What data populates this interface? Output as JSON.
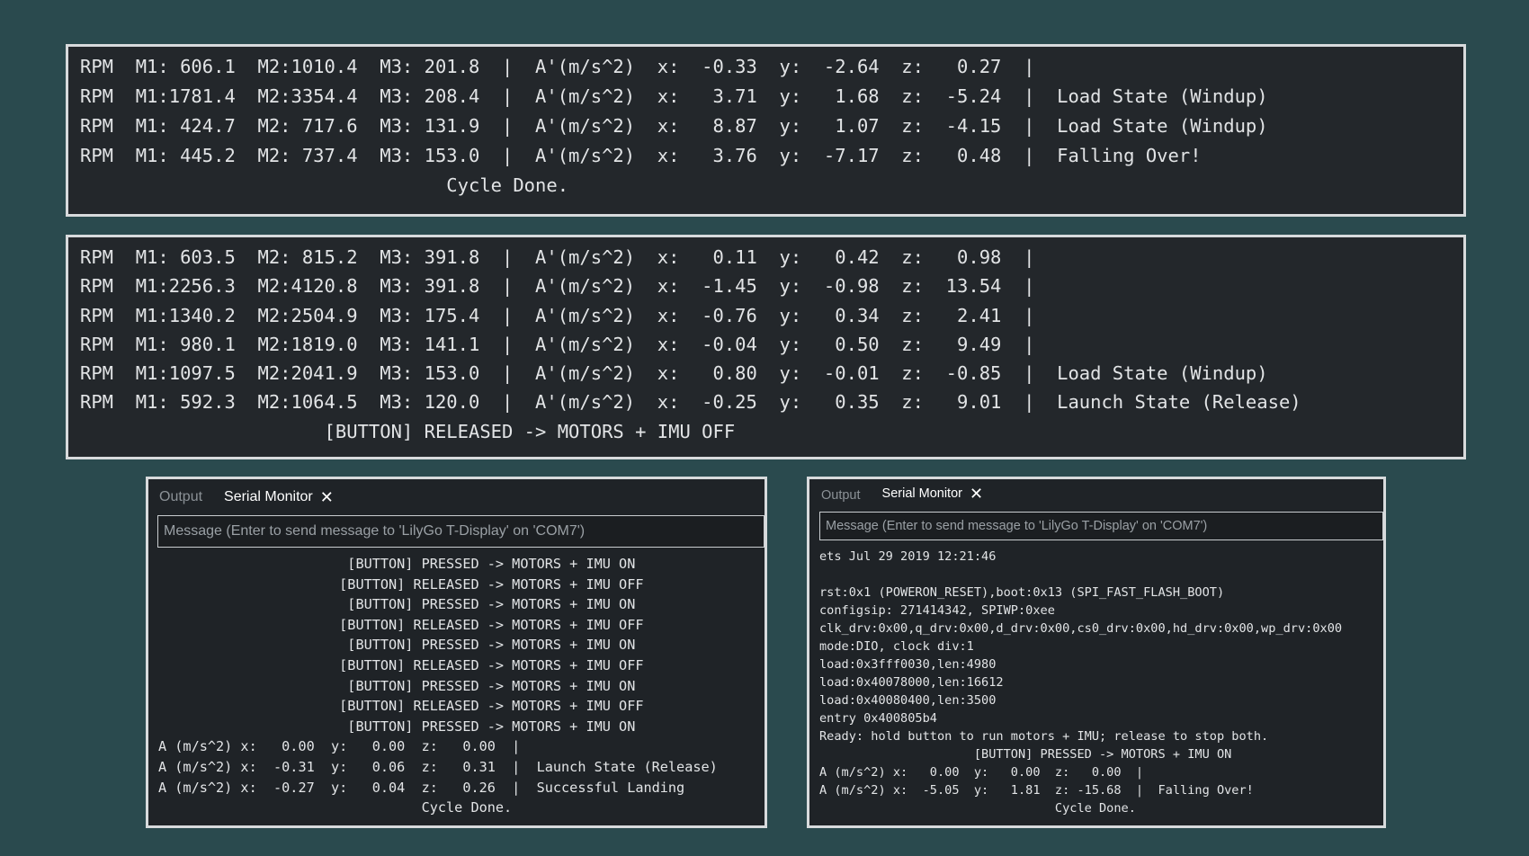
{
  "top_terminal": {
    "lines": [
      "RPM  M1: 606.1  M2:1010.4  M3: 201.8  |  A'(m/s^2)  x:  -0.33  y:  -2.64  z:   0.27  |",
      "RPM  M1:1781.4  M2:3354.4  M3: 208.4  |  A'(m/s^2)  x:   3.71  y:   1.68  z:  -5.24  |  Load State (Windup)",
      "RPM  M1: 424.7  M2: 717.6  M3: 131.9  |  A'(m/s^2)  x:   8.87  y:   1.07  z:  -4.15  |  Load State (Windup)",
      "RPM  M1: 445.2  M2: 737.4  M3: 153.0  |  A'(m/s^2)  x:   3.76  y:  -7.17  z:   0.48  |  Falling Over!",
      "                                 Cycle Done."
    ]
  },
  "mid_terminal": {
    "lines": [
      "RPM  M1: 603.5  M2: 815.2  M3: 391.8  |  A'(m/s^2)  x:   0.11  y:   0.42  z:   0.98  |",
      "RPM  M1:2256.3  M2:4120.8  M3: 391.8  |  A'(m/s^2)  x:  -1.45  y:  -0.98  z:  13.54  |",
      "RPM  M1:1340.2  M2:2504.9  M3: 175.4  |  A'(m/s^2)  x:  -0.76  y:   0.34  z:   2.41  |",
      "RPM  M1: 980.1  M2:1819.0  M3: 141.1  |  A'(m/s^2)  x:  -0.04  y:   0.50  z:   9.49  |",
      "RPM  M1:1097.5  M2:2041.9  M3: 153.0  |  A'(m/s^2)  x:   0.80  y:  -0.01  z:  -0.85  |  Load State (Windup)",
      "RPM  M1: 592.3  M2:1064.5  M3: 120.0  |  A'(m/s^2)  x:  -0.25  y:   0.35  z:   9.01  |  Launch State (Release)",
      "                      [BUTTON] RELEASED -> MOTORS + IMU OFF"
    ]
  },
  "left_panel": {
    "tab_output": "Output",
    "tab_serial": "Serial Monitor",
    "close_glyph": "✕",
    "input_placeholder": "Message (Enter to send message to 'LilyGo T-Display' on 'COM7')",
    "lines": [
      "                       [BUTTON] PRESSED -> MOTORS + IMU ON",
      "                      [BUTTON] RELEASED -> MOTORS + IMU OFF",
      "                       [BUTTON] PRESSED -> MOTORS + IMU ON",
      "                      [BUTTON] RELEASED -> MOTORS + IMU OFF",
      "                       [BUTTON] PRESSED -> MOTORS + IMU ON",
      "                      [BUTTON] RELEASED -> MOTORS + IMU OFF",
      "                       [BUTTON] PRESSED -> MOTORS + IMU ON",
      "                      [BUTTON] RELEASED -> MOTORS + IMU OFF",
      "                       [BUTTON] PRESSED -> MOTORS + IMU ON",
      "A (m/s^2) x:   0.00  y:   0.00  z:   0.00  |",
      "A (m/s^2) x:  -0.31  y:   0.06  z:   0.31  |  Launch State (Release)",
      "A (m/s^2) x:  -0.27  y:   0.04  z:   0.26  |  Successful Landing",
      "                                Cycle Done."
    ]
  },
  "right_panel": {
    "tab_output": "Output",
    "tab_serial": "Serial Monitor",
    "close_glyph": "✕",
    "input_placeholder": "Message (Enter to send message to 'LilyGo T-Display' on 'COM7')",
    "lines": [
      "ets Jul 29 2019 12:21:46",
      "",
      "rst:0x1 (POWERON_RESET),boot:0x13 (SPI_FAST_FLASH_BOOT)",
      "configsip: 271414342, SPIWP:0xee",
      "clk_drv:0x00,q_drv:0x00,d_drv:0x00,cs0_drv:0x00,hd_drv:0x00,wp_drv:0x00",
      "mode:DIO, clock div:1",
      "load:0x3fff0030,len:4980",
      "load:0x40078000,len:16612",
      "load:0x40080400,len:3500",
      "entry 0x400805b4",
      "Ready: hold button to run motors + IMU; release to stop both.",
      "                     [BUTTON] PRESSED -> MOTORS + IMU ON",
      "A (m/s^2) x:   0.00  y:   0.00  z:   0.00  |",
      "A (m/s^2) x:  -5.05  y:   1.81  z: -15.68  |  Falling Over!",
      "                                Cycle Done."
    ]
  }
}
